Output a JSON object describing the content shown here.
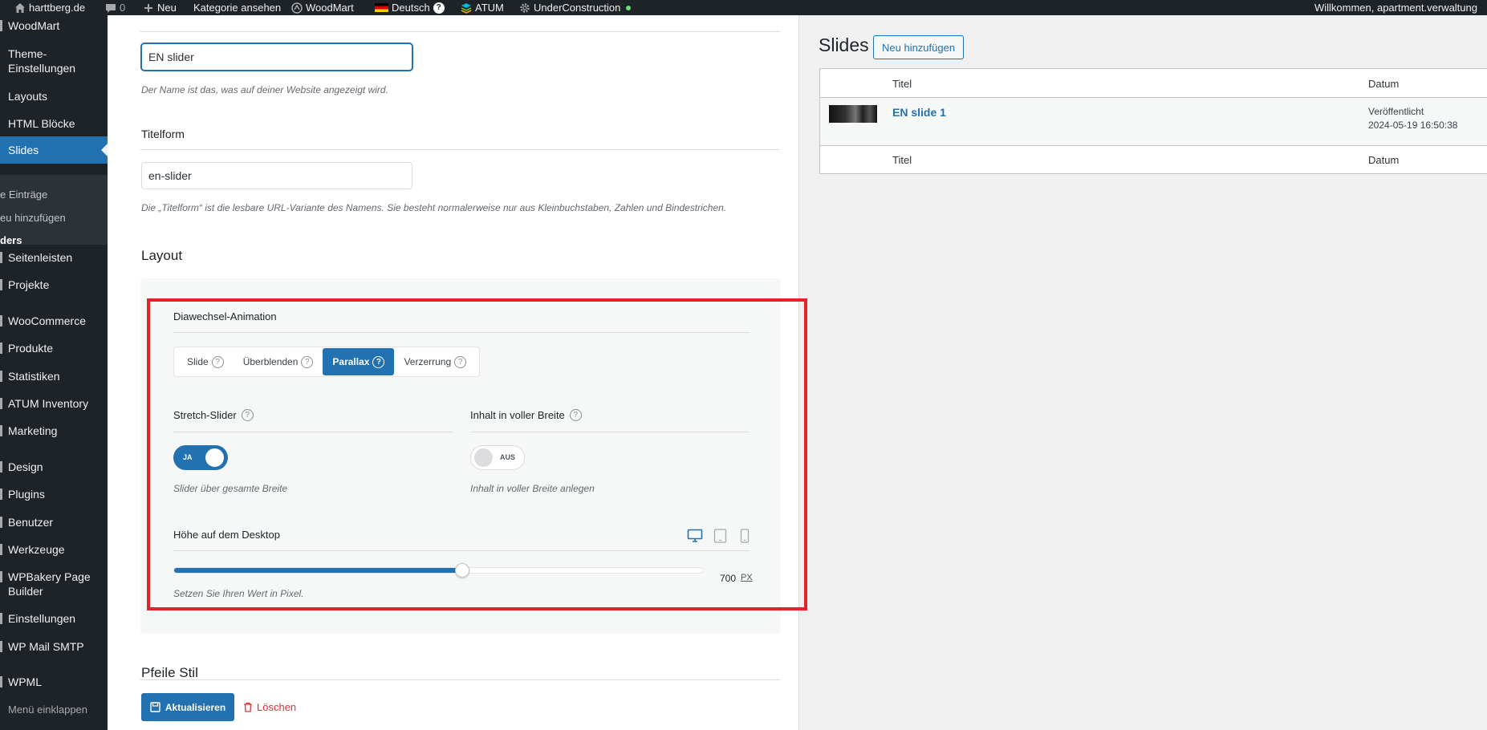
{
  "adminbar": {
    "site": "harttberg.de",
    "comments": "0",
    "new": "Neu",
    "category": "Kategorie ansehen",
    "woodmart": "WoodMart",
    "language": "Deutsch",
    "atum": "ATUM",
    "under": "UnderConstruction",
    "welcome": "Willkommen, apartment.verwaltung"
  },
  "sidebar": {
    "woodmart": "WoodMart",
    "theme1": "Theme-",
    "theme2": "Einstellungen",
    "layouts": "Layouts",
    "html": "HTML Blöcke",
    "slides": "Slides",
    "sub1": "e Einträge",
    "sub2": "eu hinzufügen",
    "sub3": "ders",
    "seitenleisten": "Seitenleisten",
    "projekte": "Projekte",
    "woocommerce": "WooCommerce",
    "produkte": "Produkte",
    "statistiken": "Statistiken",
    "atum": "ATUM Inventory",
    "marketing": "Marketing",
    "design": "Design",
    "plugins": "Plugins",
    "benutzer": "Benutzer",
    "werkzeuge": "Werkzeuge",
    "wpbakery1": "WPBakery Page",
    "wpbakery2": "Builder",
    "einstellungen": "Einstellungen",
    "smtp": "WP Mail SMTP",
    "wpml": "WPML",
    "collapse": "Menü einklappen"
  },
  "form": {
    "name_value": "EN slider",
    "name_desc": "Der Name ist das, was auf deiner Website angezeigt wird.",
    "slug_label": "Titelform",
    "slug_value": "en-slider",
    "slug_desc": "Die „Titelform“ ist die lesbare URL-Variante des Namens. Sie besteht normalerweise nur aus Kleinbuchstaben, Zahlen und Bindestrichen.",
    "layout_heading": "Layout",
    "anim_label": "Diawechsel-Animation",
    "anim_options": [
      "Slide",
      "Überblenden",
      "Parallax",
      "Verzerrung"
    ],
    "help_glyph": "?",
    "stretch_label": "Stretch-Slider",
    "stretch_state": "JA",
    "stretch_desc": "Slider über gesamte Breite",
    "full_label": "Inhalt in voller Breite",
    "full_state": "AUS",
    "full_desc": "Inhalt in voller Breite anlegen",
    "height_label": "Höhe auf dem Desktop",
    "height_value": "700",
    "height_unit": "PX",
    "height_fraction": 0.545,
    "height_desc": "Setzen Sie Ihren Wert in Pixel.",
    "arrows_heading": "Pfeile Stil",
    "update": "Aktualisieren",
    "delete": "Löschen"
  },
  "right": {
    "title": "Slides",
    "add_new": "Neu hinzufügen",
    "col_title": "Titel",
    "col_date": "Datum",
    "row_title": "EN slide 1",
    "row_status": "Veröffentlicht",
    "row_date": "2024-05-19 16:50:38"
  },
  "colors": {
    "accent": "#2271b1",
    "highlight_frame": "#e3222a",
    "adminbar": "#1d2327"
  }
}
